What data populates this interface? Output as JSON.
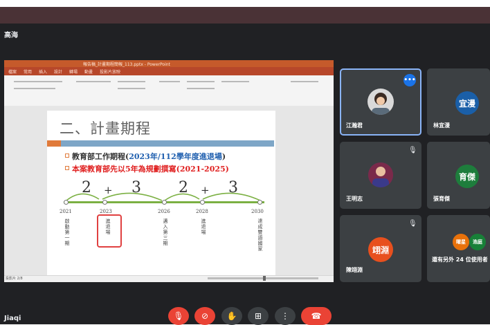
{
  "colors": {
    "browser_bar": "#4a3236",
    "meet_bg": "#202124",
    "tile_bg": "#3c4043",
    "active_border": "#8ab4f8",
    "mic_red": "#ea4335",
    "ppt_orange": "#c55a2b"
  },
  "meeting": {
    "title": "高海"
  },
  "presentation": {
    "window_title": "報告稿_計畫期程簡報_113.pptx - PowerPoint",
    "tabs": [
      "檔案",
      "常用",
      "插入",
      "設計",
      "轉場",
      "動畫",
      "投影片放映"
    ],
    "status_left": "投影片 2/8",
    "slide": {
      "title": "二、計畫期程",
      "bullet1": {
        "prefix": "教育部工作期程(",
        "highlight": "2023年/112學年度進退場",
        "suffix": ")"
      },
      "bullet2": "本案教育部先以5年為規劃撰寫(2021-2025)",
      "spans": [
        "2",
        "+",
        "3",
        "2",
        "+",
        "3"
      ],
      "years": [
        "2021",
        "2023",
        "2026",
        "2028",
        "2030"
      ],
      "milestones": [
        "啟動第一期",
        "進退場",
        "邁入第三期",
        "進退場",
        "達成雙語國家"
      ]
    }
  },
  "participants": [
    {
      "name": "江瀚君",
      "initials": "",
      "avatar_color": "#d9d9d9",
      "muted": false,
      "active": true,
      "icon": "photo-avatar"
    },
    {
      "name": "林宜漫",
      "initials": "宜漫",
      "avatar_color": "#1a5fa8",
      "muted": false,
      "active": false
    },
    {
      "name": "王明志",
      "initials": "",
      "avatar_color": "#6a2c7a",
      "muted": true,
      "active": false,
      "icon": "photo-avatar"
    },
    {
      "name": "張育傑",
      "initials": "育傑",
      "avatar_color": "#1e7d3c",
      "muted": false,
      "active": false
    },
    {
      "name": "陳翊淵",
      "initials": "翊淵",
      "avatar_color": "#e8501e",
      "muted": true,
      "active": false
    }
  ],
  "others_tile": {
    "label": "還有另外 24 位使用者",
    "avatars": [
      "曜星",
      "浩庭"
    ],
    "avatar_colors": [
      "#e8710a",
      "#188038"
    ]
  },
  "self_name": "Jiaqi",
  "controls": [
    {
      "name": "mic-off-button",
      "icon": "mic-off-icon",
      "glyph": "🎙",
      "color": "#ea4335"
    },
    {
      "name": "camera-off-button",
      "icon": "camera-off-icon",
      "glyph": "⊘",
      "color": "#ea4335"
    },
    {
      "name": "raise-hand-button",
      "icon": "hand-icon",
      "glyph": "✋",
      "color": "#3c4043"
    },
    {
      "name": "present-button",
      "icon": "present-icon",
      "glyph": "⊞",
      "color": "#3c4043"
    },
    {
      "name": "more-options-button",
      "icon": "more-vert-icon",
      "glyph": "⋮",
      "color": "#3c4043"
    },
    {
      "name": "leave-call-button",
      "icon": "hangup-icon",
      "glyph": "☎",
      "color": "#ea4335"
    }
  ]
}
